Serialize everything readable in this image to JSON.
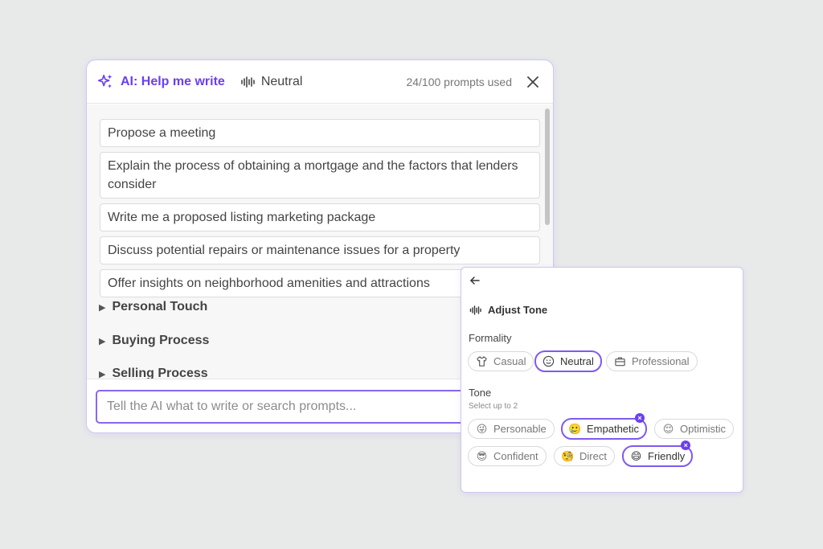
{
  "dialog": {
    "title": "AI: Help me write",
    "tone_label": "Neutral",
    "usage": "24/100 prompts used"
  },
  "prompts": [
    "Propose a meeting",
    "Explain the process of obtaining a mortgage and the factors that lenders consider",
    "Write me a proposed listing marketing package",
    "Discuss potential repairs or maintenance issues for a property",
    "Offer insights on neighborhood amenities and attractions"
  ],
  "categories": [
    "Personal Touch",
    "Buying Process",
    "Selling Process"
  ],
  "input": {
    "placeholder": "Tell the AI what to write or search prompts..."
  },
  "tone_panel": {
    "title": "Adjust Tone",
    "formality_label": "Formality",
    "formality_options": [
      {
        "label": "Casual",
        "icon": "tshirt-icon",
        "selected": false
      },
      {
        "label": "Neutral",
        "icon": "neutral-face-icon",
        "selected": true
      },
      {
        "label": "Professional",
        "icon": "briefcase-icon",
        "selected": false
      }
    ],
    "tone_label": "Tone",
    "tone_hint": "Select up to 2",
    "tone_options": [
      {
        "label": "Personable",
        "emoji": "😜",
        "selected": false
      },
      {
        "label": "Empathetic",
        "emoji": "🥲",
        "selected": true
      },
      {
        "label": "Optimistic",
        "emoji": "😌",
        "selected": false
      },
      {
        "label": "Confident",
        "emoji": "😎",
        "selected": false
      },
      {
        "label": "Direct",
        "emoji": "🧐",
        "selected": false
      },
      {
        "label": "Friendly",
        "emoji": "😄",
        "selected": true
      }
    ]
  },
  "colors": {
    "accent": "#6b3ff0",
    "page_bg": "#e8eaea"
  }
}
